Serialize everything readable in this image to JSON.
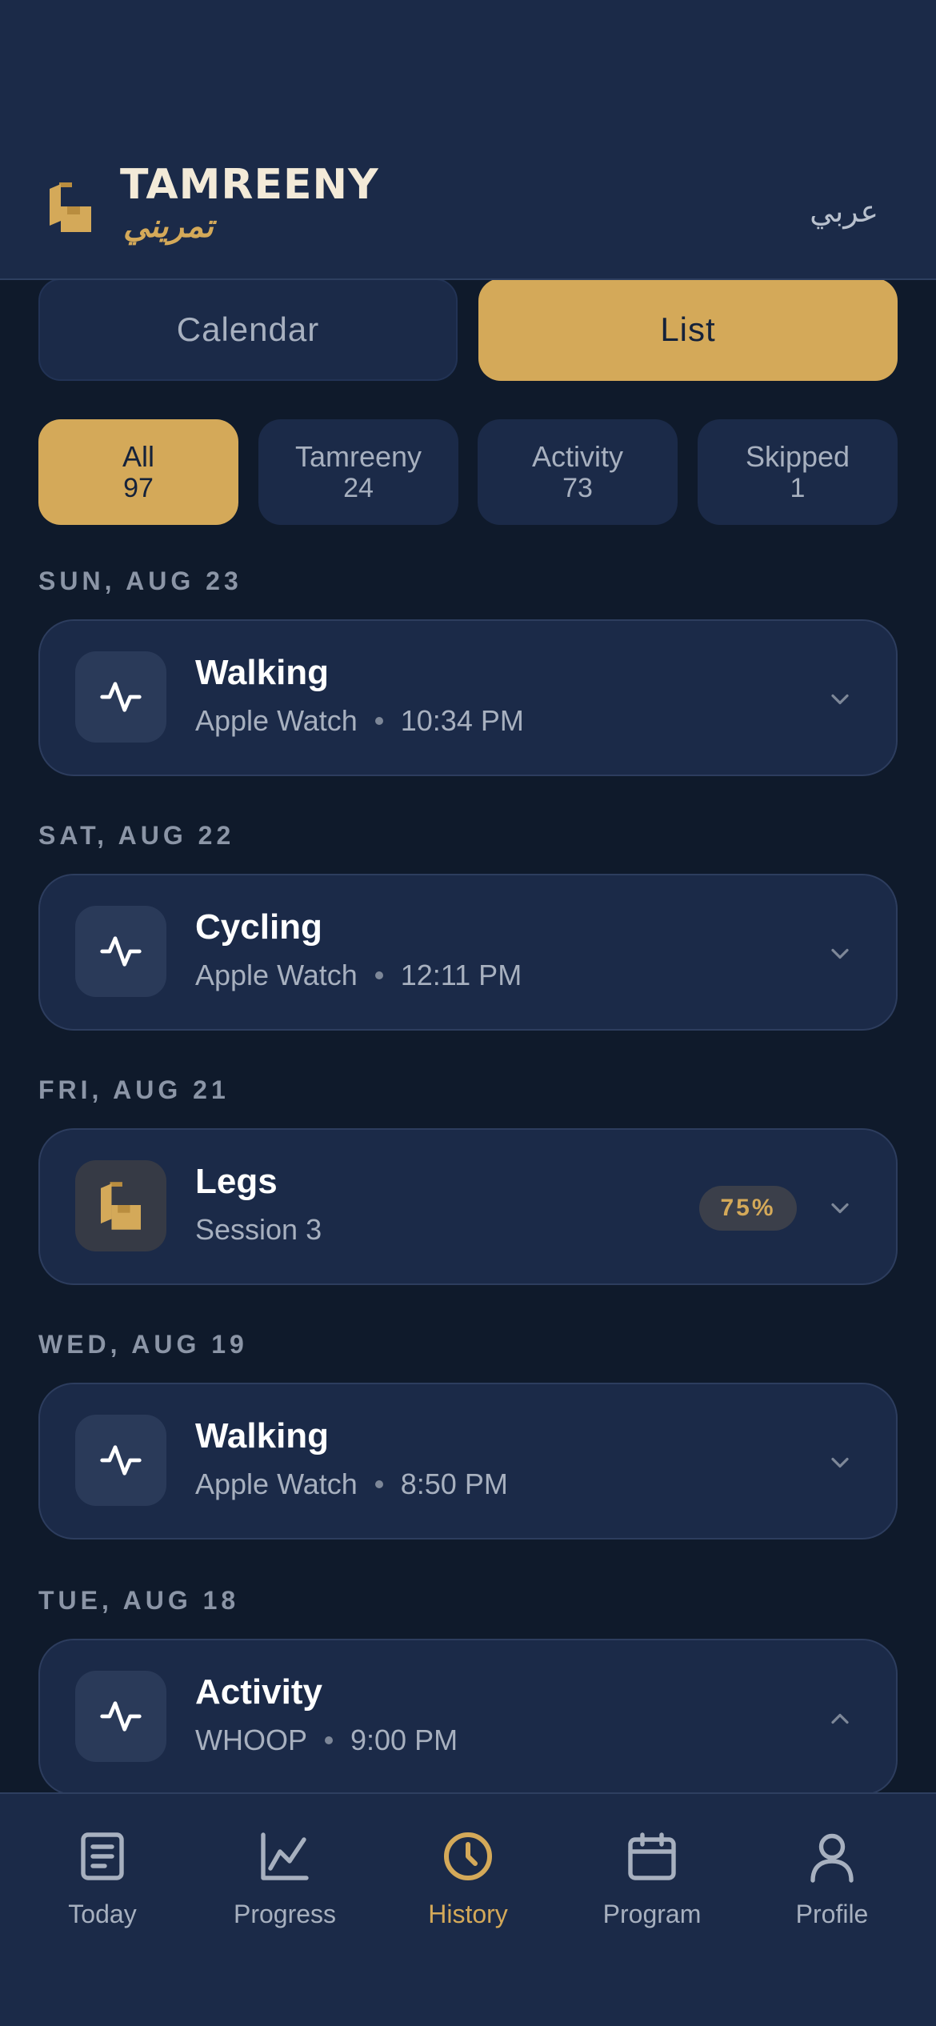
{
  "header": {
    "brand_en": "TAMREENY",
    "brand_ar": "تمريني",
    "language_toggle": "عربي"
  },
  "view_toggle": {
    "calendar_label": "Calendar",
    "list_label": "List",
    "selected": "List"
  },
  "filters": [
    {
      "label": "All",
      "count": "97",
      "active": true
    },
    {
      "label": "Tamreeny",
      "count": "24",
      "active": false
    },
    {
      "label": "Activity",
      "count": "73",
      "active": false
    },
    {
      "label": "Skipped",
      "count": "1",
      "active": false
    }
  ],
  "history": [
    {
      "date": "SUN, AUG 23",
      "title": "Walking",
      "source": "Apple Watch",
      "time": "10:34 PM",
      "icon": "activity-pulse-icon",
      "expanded": false
    },
    {
      "date": "SAT, AUG 22",
      "title": "Cycling",
      "source": "Apple Watch",
      "time": "12:11 PM",
      "icon": "activity-pulse-icon",
      "expanded": false
    },
    {
      "date": "FRI, AUG 21",
      "title": "Legs",
      "subtitle": "Session 3",
      "badge": "75%",
      "icon": "tamreeny-logo-icon",
      "expanded": false
    },
    {
      "date": "WED, AUG 19",
      "title": "Walking",
      "source": "Apple Watch",
      "time": "8:50 PM",
      "icon": "activity-pulse-icon",
      "expanded": false
    },
    {
      "date": "TUE, AUG 18",
      "title": "Activity",
      "source": "WHOOP",
      "time": "9:00 PM",
      "icon": "activity-pulse-icon",
      "expanded": true
    }
  ],
  "bottom_nav": [
    {
      "label": "Today",
      "icon": "journal-icon",
      "active": false
    },
    {
      "label": "Progress",
      "icon": "chart-line-icon",
      "active": false
    },
    {
      "label": "History",
      "icon": "clock-icon",
      "active": true
    },
    {
      "label": "Program",
      "icon": "calendar-icon",
      "active": false
    },
    {
      "label": "Profile",
      "icon": "user-icon",
      "active": false
    }
  ],
  "colors": {
    "accent": "#d4a959",
    "background": "#0f1a2b",
    "surface": "#1b2a48",
    "text_muted": "#a7b0bf"
  }
}
